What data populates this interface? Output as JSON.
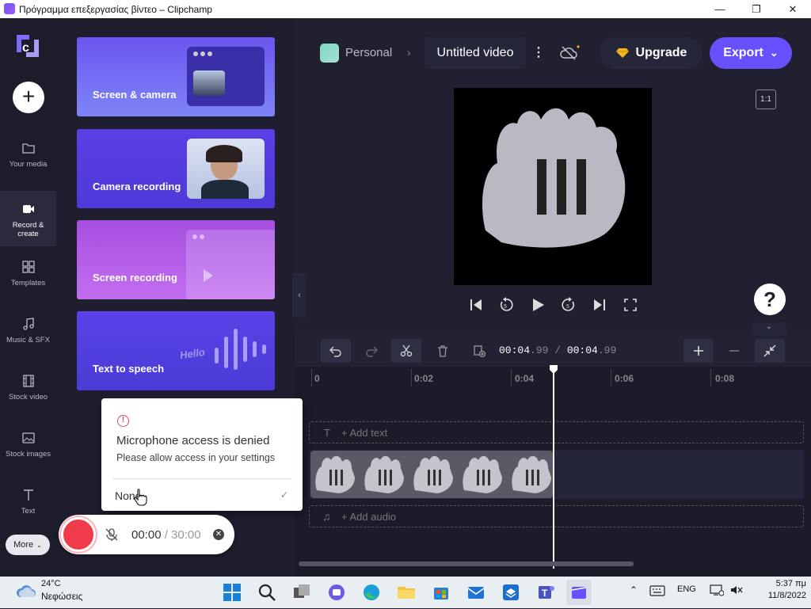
{
  "window": {
    "title": "Πρόγραμμα επεξεργασίας βίντεο – Clipchamp",
    "minimize": "—",
    "maximize": "❐",
    "close": "✕"
  },
  "nav": {
    "add_label": "+",
    "items": [
      {
        "label": "Your media",
        "icon": "folder-icon"
      },
      {
        "label": "Record & create",
        "icon": "camera-icon"
      },
      {
        "label": "Templates",
        "icon": "templates-icon"
      },
      {
        "label": "Music & SFX",
        "icon": "music-icon"
      },
      {
        "label": "Stock video",
        "icon": "film-icon"
      },
      {
        "label": "Stock images",
        "icon": "image-icon"
      },
      {
        "label": "Text",
        "icon": "text-icon"
      }
    ],
    "more": "More"
  },
  "panel": {
    "cards": [
      {
        "label": "Screen & camera"
      },
      {
        "label": "Camera recording"
      },
      {
        "label": "Screen recording"
      },
      {
        "label": "Text to speech",
        "hello": "Hello"
      }
    ]
  },
  "popup": {
    "title": "Microphone access is denied",
    "subtitle": "Please allow access in your settings",
    "option": "None"
  },
  "recorder": {
    "elapsed": "00:00",
    "separator": " / ",
    "limit": "30:00"
  },
  "header": {
    "workspace": "Personal",
    "project_title": "Untitled video",
    "upgrade": "Upgrade",
    "export": "Export",
    "aspect_ratio": "1:1"
  },
  "timeline": {
    "current_time": "00:04",
    "current_frac": ".99",
    "separator": " / ",
    "total_time": "00:04",
    "total_frac": ".99",
    "ruler": [
      "0",
      "0:02",
      "0:04",
      "0:06",
      "0:08"
    ],
    "add_text": "+ Add text",
    "add_audio": "+ Add audio",
    "text_track_icon": "T",
    "audio_track_icon": "♫"
  },
  "taskbar": {
    "temperature": "24°C",
    "weather": "Νεφώσεις",
    "language": "ENG",
    "time": "5:37 πμ",
    "date": "11/8/2022"
  },
  "colors": {
    "accent": "#6751ff",
    "record": "#ef3b4a",
    "warning": "#e0455a"
  }
}
